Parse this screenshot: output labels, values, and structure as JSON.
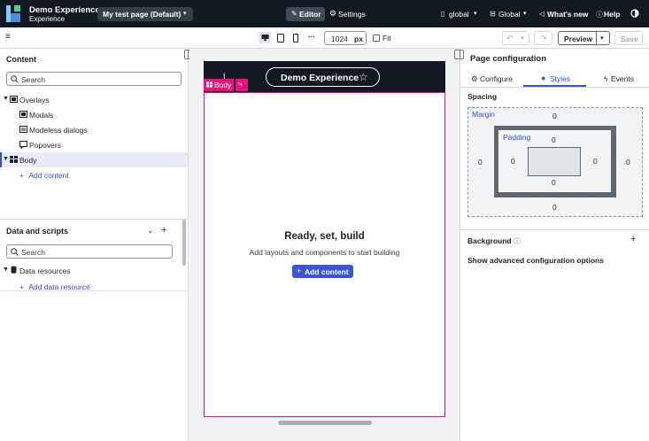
{
  "app": {
    "title": "Demo Experience",
    "subtitle": "Experience"
  },
  "header": {
    "page_selector": "My test page (Default)",
    "editor_label": "Editor",
    "settings_label": "Settings",
    "scope_global_lower": "global",
    "scope_global_upper": "Global",
    "whats_new": "What's new",
    "help": "Help"
  },
  "toolbar": {
    "menu_icon": "≡",
    "width_value": "1024",
    "width_unit": "px",
    "fit_label": "Fit",
    "more_label": "···",
    "preview_label": "Preview",
    "save_label": "Save"
  },
  "left": {
    "content_title": "Content",
    "search_placeholder": "Search",
    "tree": [
      {
        "label": "Overlays"
      },
      {
        "label": "Modals"
      },
      {
        "label": "Modeless dialogs"
      },
      {
        "label": "Popovers"
      },
      {
        "label": "Body"
      }
    ],
    "add_content": "Add content",
    "data_scripts_title": "Data and scripts",
    "data_search_placeholder": "Search",
    "data_resources": "Data resources",
    "add_data_resource": "Add data resource"
  },
  "canvas": {
    "experience_pill": "Demo Experience",
    "body_tag": "Body",
    "empty_title": "Ready, set, build",
    "empty_subtitle": "Add layouts and components to start building",
    "add_content_button": "Add content"
  },
  "right": {
    "title": "Page configuration",
    "tabs": [
      "Configure",
      "Styles",
      "Events"
    ],
    "active_tab": "Styles",
    "spacing_title": "Spacing",
    "margin_label": "Margin",
    "padding_label": "Padding",
    "margin": {
      "top": "0",
      "right": "0",
      "bottom": "0",
      "left": "0"
    },
    "padding": {
      "top": "0",
      "right": "0",
      "bottom": "0",
      "left": "0"
    },
    "background_title": "Background",
    "advanced_link": "Show advanced configuration options"
  },
  "colors": {
    "topbar": "#121922",
    "accent": "#2f4fd6",
    "selection": "#e5137b",
    "highlight": "#e8eaf8"
  }
}
